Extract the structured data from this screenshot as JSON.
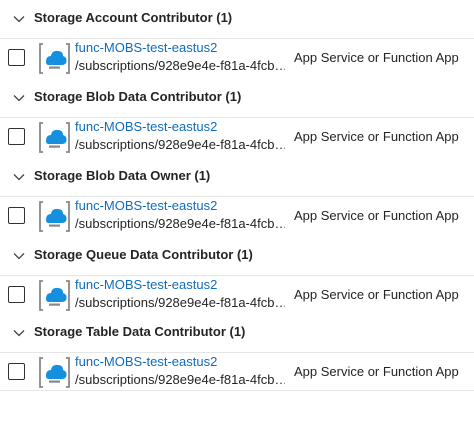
{
  "groups": [
    {
      "title": "Storage Account Contributor (1)",
      "items": [
        {
          "name": "func-MOBS-test-eastus2",
          "path": "/subscriptions/928e9e4e-f81a-4fcb…",
          "type": "App Service or Function App",
          "icon": "function-app-icon"
        }
      ]
    },
    {
      "title": "Storage Blob Data Contributor (1)",
      "items": [
        {
          "name": "func-MOBS-test-eastus2",
          "path": "/subscriptions/928e9e4e-f81a-4fcb…",
          "type": "App Service or Function App",
          "icon": "function-app-icon"
        }
      ]
    },
    {
      "title": "Storage Blob Data Owner (1)",
      "items": [
        {
          "name": "func-MOBS-test-eastus2",
          "path": "/subscriptions/928e9e4e-f81a-4fcb…",
          "type": "App Service or Function App",
          "icon": "function-app-icon"
        }
      ]
    },
    {
      "title": "Storage Queue Data Contributor (1)",
      "items": [
        {
          "name": "func-MOBS-test-eastus2",
          "path": "/subscriptions/928e9e4e-f81a-4fcb…",
          "type": "App Service or Function App",
          "icon": "function-app-icon"
        }
      ]
    },
    {
      "title": "Storage Table Data Contributor (1)",
      "items": [
        {
          "name": "func-MOBS-test-eastus2",
          "path": "/subscriptions/928e9e4e-f81a-4fcb…",
          "type": "App Service or Function App",
          "icon": "function-app-icon"
        }
      ]
    }
  ],
  "colors": {
    "link": "#0f6cbd",
    "text": "#242424",
    "divider": "#e6e6e6",
    "icon_blue": "#1490df",
    "icon_gray": "#8a8886"
  }
}
